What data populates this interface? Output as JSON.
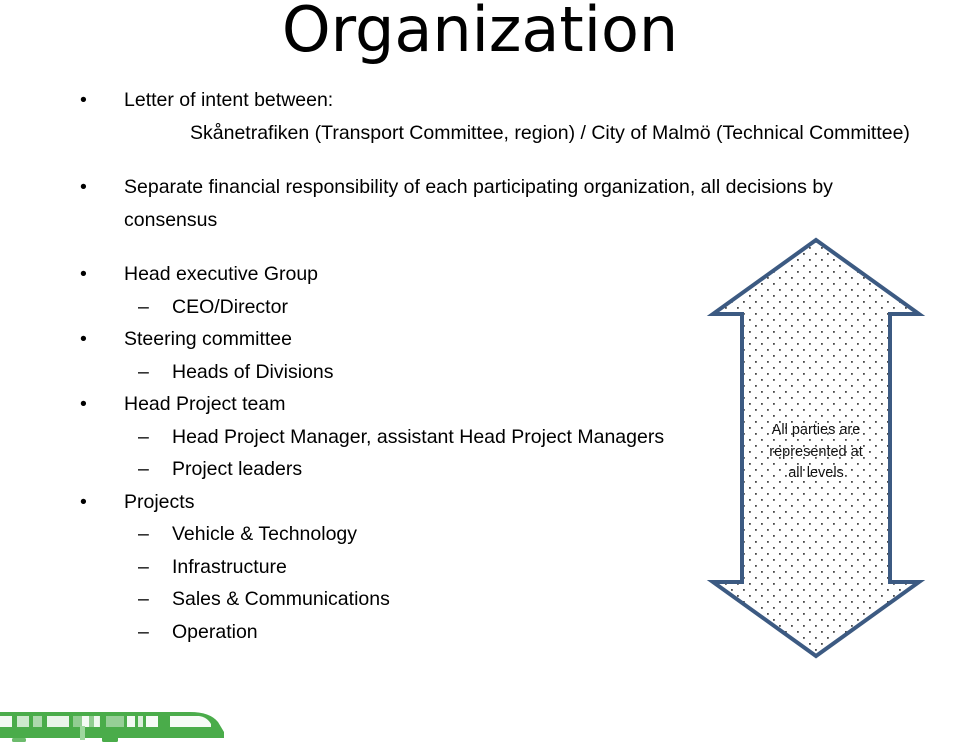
{
  "slide": {
    "title": "Organization",
    "background_color": "#ffffff",
    "text_color": "#000000"
  },
  "content": {
    "items": [
      {
        "level": 1,
        "marker": "•",
        "text": "Letter of intent between:"
      },
      {
        "level": 0,
        "marker": "",
        "text": "Skånetrafiken (Transport Committee, region) / City of Malmö (Technical Committee)"
      },
      {
        "level": 1,
        "marker": "•",
        "text": "Separate financial responsibility of each participating organization, all decisions by consensus"
      },
      {
        "level": 1,
        "marker": "•",
        "text": "Head executive Group"
      },
      {
        "level": 2,
        "marker": "–",
        "text": "CEO/Director"
      },
      {
        "level": 1,
        "marker": "•",
        "text": "Steering committee"
      },
      {
        "level": 2,
        "marker": "–",
        "text": "Heads of Divisions"
      },
      {
        "level": 1,
        "marker": "•",
        "text": "Head Project team"
      },
      {
        "level": 2,
        "marker": "–",
        "text": "Head Project Manager, assistant Head Project Managers"
      },
      {
        "level": 2,
        "marker": "–",
        "text": "Project leaders"
      },
      {
        "level": 1,
        "marker": "•",
        "text": "Projects"
      },
      {
        "level": 2,
        "marker": "–",
        "text": "Vehicle & Technology"
      },
      {
        "level": 2,
        "marker": "–",
        "text": "Infrastructure"
      },
      {
        "level": 2,
        "marker": "–",
        "text": "Sales & Communications"
      },
      {
        "level": 2,
        "marker": "–",
        "text": "Operation"
      }
    ]
  },
  "arrow_graphic": {
    "name": "double-headed-vertical-arrow",
    "caption_lines": [
      "All parties are",
      "represented at",
      "all levels"
    ],
    "outline_color": "#3c5a82",
    "fill_color": "#ffffff",
    "dot_color": "#444444"
  },
  "train_graphic": {
    "name": "green-train-silhouette",
    "color": "#4aac4a",
    "light_color": "#8fcf8f"
  }
}
